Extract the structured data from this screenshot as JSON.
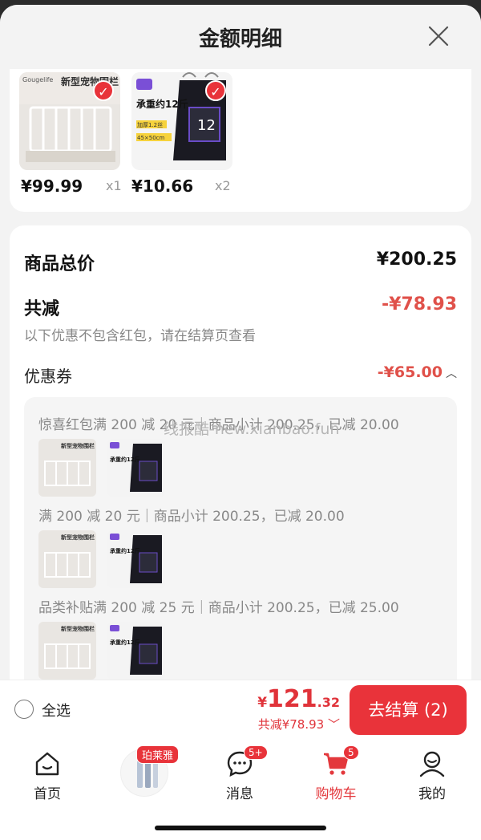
{
  "header": {
    "title": "金额明细"
  },
  "products": [
    {
      "price": "¥99.99",
      "qty": "x1",
      "image_text": "新型宠物围栏",
      "brand": "Gougelife"
    },
    {
      "price": "¥10.66",
      "qty": "x2",
      "image_text": "承重约12斤",
      "sub_text": "加厚1.2丝",
      "size": "45×50cm",
      "number": "12"
    }
  ],
  "summary": {
    "total_label": "商品总价",
    "total_value": "¥200.25",
    "discount_label": "共减",
    "discount_value": "-¥78.93",
    "note": "以下优惠不包含红包，请在结算页查看",
    "coupon_label": "优惠券",
    "coupon_value": "-¥65.00"
  },
  "discounts": [
    {
      "text": "惊喜红包满 200 减 20 元｜商品小计 200.25，已减 20.00"
    },
    {
      "text": "满 200 减 20 元｜商品小计 200.25，已减 20.00"
    },
    {
      "text": "品类补贴满 200 减 25 元｜商品小计 200.25，已减 25.00"
    }
  ],
  "watermark": "线报酷-new.xianbao.fun",
  "checkout": {
    "select_all": "全选",
    "currency": "¥",
    "total_int": "121",
    "total_dec": ".32",
    "saving": "共减¥78.93",
    "button": "去结算 (2)"
  },
  "tabbar": {
    "promo_badge": "珀莱雅",
    "items": [
      {
        "label": "首页"
      },
      {
        "label": "消息",
        "badge": "5+"
      },
      {
        "label": "购物车",
        "badge": "5"
      },
      {
        "label": "我的"
      }
    ]
  },
  "colors": {
    "accent": "#e9333a",
    "discount_text": "#e0514a"
  }
}
